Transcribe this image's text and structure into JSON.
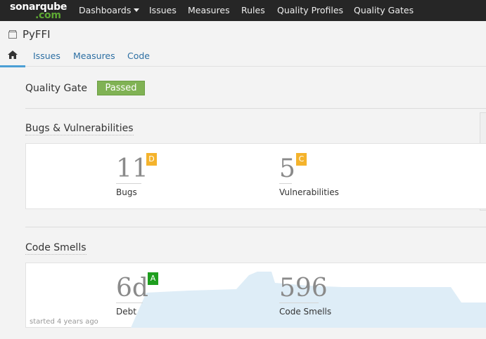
{
  "topnav": {
    "logo_line1": "sonarqube",
    "logo_line2": ".com",
    "items": [
      "Dashboards",
      "Issues",
      "Measures",
      "Rules",
      "Quality Profiles",
      "Quality Gates"
    ]
  },
  "project": {
    "name": "PyFFI",
    "tabs": [
      "Issues",
      "Measures",
      "Code"
    ]
  },
  "quality_gate": {
    "label": "Quality Gate",
    "status": "Passed",
    "status_color": "#80b254"
  },
  "bugs_section": {
    "title": "Bugs & Vulnerabilities",
    "bugs": {
      "value": "11",
      "label": "Bugs",
      "rating": "D",
      "rating_color": "#f4b32c"
    },
    "vulnerabilities": {
      "value": "5",
      "label": "Vulnerabilities",
      "rating": "C",
      "rating_color": "#f4b32c"
    }
  },
  "smells_section": {
    "title": "Code Smells",
    "debt": {
      "value": "6d",
      "label": "Debt",
      "rating": "A",
      "rating_color": "#1e9e1e"
    },
    "code_smells": {
      "value": "596",
      "label": "Code Smells"
    },
    "history_note": "started 4 years ago",
    "history_color": "#deedf7"
  }
}
